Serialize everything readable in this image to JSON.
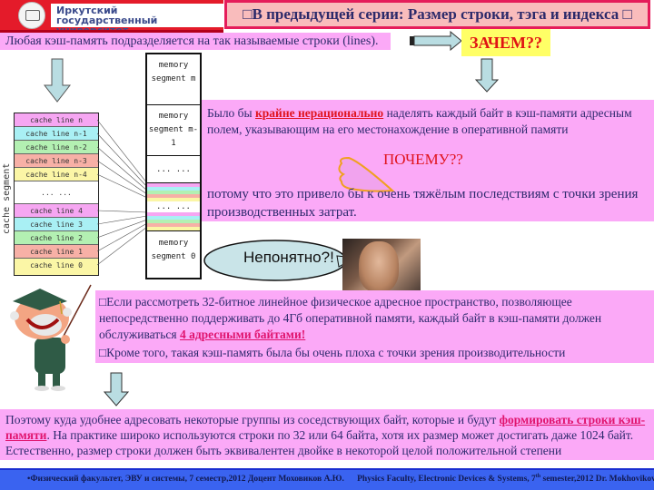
{
  "header": {
    "university_line1": "Иркутский",
    "university_line2": "государственный университет",
    "logo_icon": "university-emblem-icon"
  },
  "title": {
    "text": "□В предыдущей серии: Размер строки, тэга и индекса □"
  },
  "intro": {
    "text": "Любая кэш-память подразделяется на так называемые строки (lines)."
  },
  "zachem": {
    "text": "ЗАЧЕМ??"
  },
  "diagram": {
    "cache_segment_label": "cache segment",
    "cache_lines": [
      {
        "label": "cache line n",
        "color": "#f6a6f2"
      },
      {
        "label": "cache line n-1",
        "color": "#a9f0f4"
      },
      {
        "label": "cache line n-2",
        "color": "#b3f0b2"
      },
      {
        "label": "cache line n-3",
        "color": "#f7b0a6"
      },
      {
        "label": "cache line n-4",
        "color": "#fbf6a6"
      },
      {
        "label": "... ...",
        "color": "#ffffff"
      },
      {
        "label": "cache line 4",
        "color": "#f6a6f2"
      },
      {
        "label": "cache line 3",
        "color": "#a9f0f4"
      },
      {
        "label": "cache line 2",
        "color": "#b3f0b2"
      },
      {
        "label": "cache line 1",
        "color": "#f7b0a6"
      },
      {
        "label": "cache line 0",
        "color": "#fbf6a6"
      }
    ],
    "memory_segments": {
      "top": "memory segment m",
      "second": "memory segment m-1",
      "ellipsis": "... ...",
      "middle_ellipsis": "... ...",
      "bottom": "memory segment 0"
    }
  },
  "explanation": {
    "p1_before": "Было бы ",
    "p1_highlight": "крайне нерационально",
    "p1_after": " наделять каждый байт в кэш-памяти адресным полем, указывающим на его местонахождение в оперативной памяти",
    "pochemu": "ПОЧЕМУ??",
    "p2": "потому что это привело бы к очень тяжёлым последствиям с точки зрения производственных затрат."
  },
  "bubble": {
    "text": "Непонятно?!"
  },
  "box2": {
    "p1_before": "□Если рассмотреть 32-битное линейное физическое адресное пространство, позволяющее непосредственно поддерживать до 4Гб оперативной памяти, каждый байт в кэш-памяти должен обслуживаться ",
    "p1_highlight": "4 адресными байтами!",
    "p2": "□Кроме того, такая кэш-память была бы очень плоха с точки зрения производительности"
  },
  "box3": {
    "before": "Поэтому куда удобнее адресовать некоторые группы из соседствующих байт, которые и будут ",
    "highlight": "формировать строки кэш-памяти",
    "after": ". На практике широко используются строки по 32 или 64 байта, хотя их размер может достигать даже 1024 байт. Естественно, размер строки должен быть эквивалентен двойке в некоторой целой положительной степени"
  },
  "footer": {
    "ru": "•Физический факультет, ЭВУ и системы, 7 семестр,2012 Доцент Моховиков А.Ю.",
    "en_before": "Physics Faculty, Electronic Devices & Systems, 7",
    "en_sup": "th",
    "en_after": " semester,2012   Dr. Mokhovikov"
  },
  "colors": {
    "header_red": "#e41b2a",
    "pink_box": "#fba9f7",
    "title_border": "#e51c5a",
    "highlight_red": "#e0141e",
    "footer_blue": "#3a63f0",
    "arrow_fill": "#b9dde2"
  }
}
